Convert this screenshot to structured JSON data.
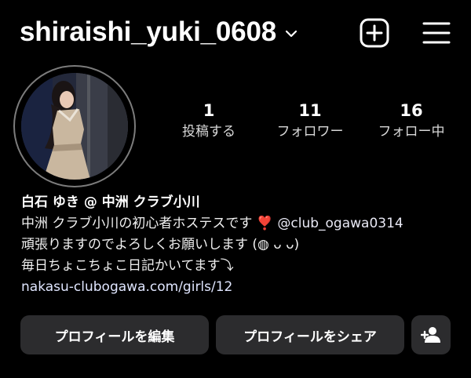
{
  "header": {
    "username": "shiraishi_yuki_0608",
    "icons": {
      "dropdown": "chevron-down-icon",
      "create": "plus-square-icon",
      "menu": "hamburger-menu-icon"
    }
  },
  "stats": [
    {
      "count": "1",
      "label": "投稿する"
    },
    {
      "count": "11",
      "label": "フォロワー"
    },
    {
      "count": "16",
      "label": "フォロー中"
    }
  ],
  "bio": {
    "name": "白石 ゆき @ 中洲 クラブ小川",
    "line1_text": "中洲 クラブ小川の初心者ホステスです",
    "line1_emoji": "❣️",
    "line1_mention": "@club_ogawa0314",
    "line2": "頑張りますのでよろしくお願いします (◍ ᴗ ᴗ)",
    "line3": "毎日ちょこちょこ日記かいてます⤵︎",
    "link": "nakasu-clubogawa.com/girls/12"
  },
  "actions": {
    "edit_profile": "プロフィールを編集",
    "share_profile": "プロフィールをシェア",
    "discover_icon": "add-person-icon"
  },
  "colors": {
    "background": "#000000",
    "button": "#2c2c2e",
    "text": "#ffffff",
    "heart": "#e0245e"
  }
}
